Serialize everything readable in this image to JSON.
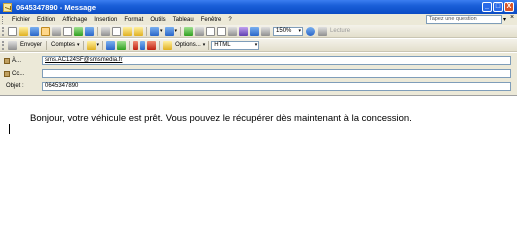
{
  "window": {
    "title": "0645347890 - Message",
    "buttons": {
      "minimize": "_",
      "maximize": "□",
      "close": "X"
    }
  },
  "menubar": {
    "items": [
      "Fichier",
      "Edition",
      "Affichage",
      "Insertion",
      "Format",
      "Outils",
      "Tableau",
      "Fenêtre",
      "?"
    ],
    "help_placeholder": "Tapez une question",
    "help_arrow": "▾",
    "close_glyph": "×"
  },
  "toolbar1": {
    "zoom_value": "150%",
    "read_label": "Lecture",
    "arrow_glyph": "▾"
  },
  "toolbar2": {
    "send_label": "Envoyer",
    "accounts_label": "Comptes",
    "options_label": "Options...",
    "format_value": "HTML",
    "arrow_glyph": "▾"
  },
  "fields": {
    "to_label": "À...",
    "to_value": "sms.AC124SF@smsmedia.fr",
    "cc_label": "Cc...",
    "cc_value": "",
    "subject_label": "Objet :",
    "subject_value": "0645347890"
  },
  "message": {
    "body": "Bonjour, votre véhicule est prêt. Vous pouvez le récupérer dès maintenant à la concession."
  }
}
